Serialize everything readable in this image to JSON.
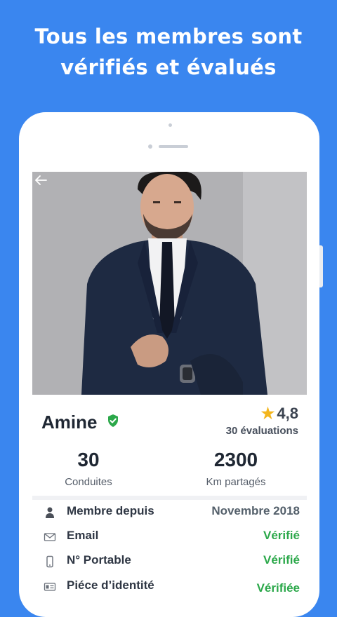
{
  "headline": {
    "line1": "Tous les membres sont",
    "line2": "vérifiés et évalués"
  },
  "colors": {
    "background": "#3a86ef",
    "verified_green": "#2ba84a",
    "star": "#f3b51d"
  },
  "profile": {
    "back_icon": "back-arrow-icon",
    "photo": "profile-photo",
    "name": "Amine",
    "verified_icon": "verified-shield-icon",
    "rating": "4,8",
    "reviews": "30 évaluations"
  },
  "stats": [
    {
      "value": "30",
      "label": "Conduites"
    },
    {
      "value": "2300",
      "label": "Km partagés"
    }
  ],
  "details": [
    {
      "icon": "person-icon",
      "label": "Membre depuis",
      "value": "Novembre 2018",
      "status": "neutral"
    },
    {
      "icon": "email-icon",
      "label": "Email",
      "value": "Vérifié",
      "status": "verified"
    },
    {
      "icon": "phone-icon",
      "label": "N° Portable",
      "value": "Vérifié",
      "status": "verified"
    },
    {
      "icon": "id-card-icon",
      "label": "Piéce d’identité",
      "value": "Vérifiée",
      "status": "verified"
    }
  ]
}
